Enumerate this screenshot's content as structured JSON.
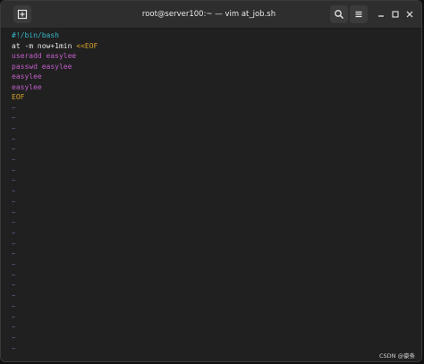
{
  "window": {
    "title": "root@server100:~ — vim at_job.sh",
    "buttons": {
      "new_tab_icon": "new-tab-icon",
      "search_icon": "search-icon",
      "menu_icon": "hamburger-menu-icon",
      "minimize_icon": "minimize-icon",
      "maximize_icon": "maximize-icon",
      "close_icon": "close-icon"
    }
  },
  "editor": {
    "lines": [
      {
        "segments": [
          {
            "text": "#!/bin/bash",
            "color": "#35b7c7"
          }
        ]
      },
      {
        "segments": [
          {
            "text": "at -m now+1min ",
            "color": "#e9e9e9"
          },
          {
            "text": "<<EOF",
            "color": "#d7a12b"
          }
        ]
      },
      {
        "segments": [
          {
            "text": "useradd easylee",
            "color": "#c05ec8"
          }
        ]
      },
      {
        "segments": [
          {
            "text": "passwd easylee",
            "color": "#c05ec8"
          }
        ]
      },
      {
        "segments": [
          {
            "text": "easylee",
            "color": "#c05ec8"
          }
        ]
      },
      {
        "segments": [
          {
            "text": "easylee",
            "color": "#c05ec8"
          }
        ]
      },
      {
        "segments": [
          {
            "text": "EOF",
            "color": "#d7a12b"
          }
        ]
      }
    ],
    "empty_line_marker": "~"
  },
  "watermark": "CSDN @豪条"
}
